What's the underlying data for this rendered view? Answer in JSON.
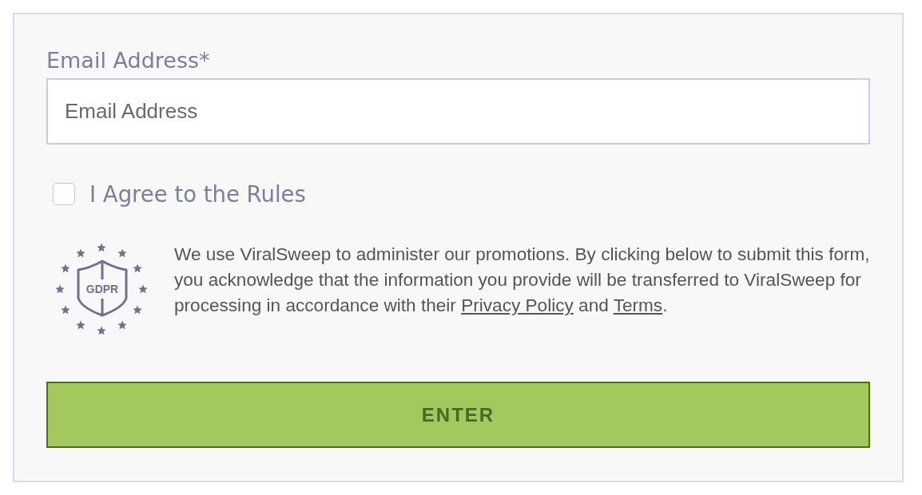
{
  "email": {
    "label": "Email Address*",
    "placeholder": "Email Address"
  },
  "agree": {
    "label": "I Agree to the Rules",
    "checked": false
  },
  "gdpr": {
    "badge": "GDPR",
    "notice": [
      {
        "kind": "text",
        "text": "We use ViralSweep to administer our promotions. By clicking below to submit this form, you acknowledge that the information you provide will be transferred to ViralSweep for processing in accordance with their "
      },
      {
        "kind": "link",
        "text": "Privacy Policy"
      },
      {
        "kind": "text",
        "text": " and "
      },
      {
        "kind": "link",
        "text": "Terms"
      },
      {
        "kind": "text",
        "text": "."
      }
    ]
  },
  "submit": {
    "label": "ENTER"
  }
}
